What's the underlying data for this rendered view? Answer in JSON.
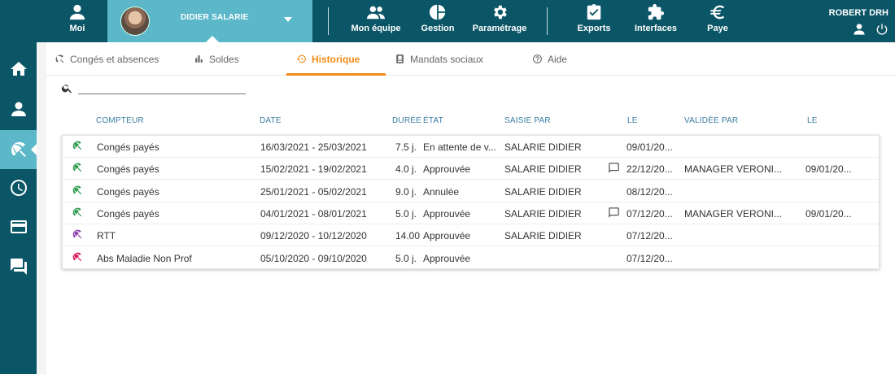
{
  "topnav": {
    "moi": "Moi",
    "user_name": "DIDIER SALARIE",
    "mon_equipe": "Mon équipe",
    "gestion": "Gestion",
    "parametrage": "Paramétrage",
    "exports": "Exports",
    "interfaces": "Interfaces",
    "paye": "Paye",
    "account_name": "ROBERT DRH"
  },
  "sidebar": {
    "items": [
      "home-icon",
      "person-icon",
      "beach-umbrella-icon",
      "clock-icon",
      "card-icon",
      "chat-icon"
    ],
    "active_index": 2
  },
  "tabs": [
    {
      "label": "Congés et absences",
      "icon": "umbrella-icon"
    },
    {
      "label": "Soldes",
      "icon": "bar-chart-icon"
    },
    {
      "label": "Historique",
      "icon": "history-icon",
      "active": true
    },
    {
      "label": "Mandats sociaux",
      "icon": "badge-icon"
    },
    {
      "label": "Aide",
      "icon": "help-icon"
    }
  ],
  "search": {
    "value": "",
    "placeholder": ""
  },
  "columns": {
    "compteur": "COMPTEUR",
    "date": "DATE",
    "duree": "DURÉE",
    "etat": "ÉTAT",
    "saisie_par": "SAISIE PAR",
    "le1": "LE",
    "validee_par": "VALIDÉE PAR",
    "le2": "LE"
  },
  "colors": {
    "topbar": "#0a5566",
    "accent": "#5cb8c9",
    "active_tab": "#f08a14",
    "umbrella_green": "#2e9b4f",
    "umbrella_purple": "#8e44ad",
    "umbrella_pink": "#d81b60"
  },
  "rows": [
    {
      "compteur": "Congés payés",
      "color": "green",
      "date": "16/03/2021 - 25/03/2021",
      "duree": "7.5 j.",
      "etat": "En attente de v...",
      "saisie": "SALARIE DIDIER",
      "comment": false,
      "le1": "09/01/20...",
      "validee": "",
      "le2": ""
    },
    {
      "compteur": "Congés payés",
      "color": "green",
      "date": "15/02/2021 - 19/02/2021",
      "duree": "4.0 j.",
      "etat": "Approuvée",
      "saisie": "SALARIE DIDIER",
      "comment": true,
      "le1": "22/12/20...",
      "validee": "MANAGER VERONI...",
      "le2": "09/01/20..."
    },
    {
      "compteur": "Congés payés",
      "color": "green",
      "date": "25/01/2021 - 05/02/2021",
      "duree": "9.0 j.",
      "etat": "Annulée",
      "saisie": "SALARIE DIDIER",
      "comment": false,
      "le1": "08/12/20...",
      "validee": "",
      "le2": ""
    },
    {
      "compteur": "Congés payés",
      "color": "green",
      "date": "04/01/2021 - 08/01/2021",
      "duree": "5.0 j.",
      "etat": "Approuvée",
      "saisie": "SALARIE DIDIER",
      "comment": true,
      "le1": "07/12/20...",
      "validee": "MANAGER VERONI...",
      "le2": "09/01/20..."
    },
    {
      "compteur": "RTT",
      "color": "purple",
      "date": "09/12/2020 - 10/12/2020",
      "duree": "14.00 ...",
      "etat": "Approuvée",
      "saisie": "SALARIE DIDIER",
      "comment": false,
      "le1": "07/12/20...",
      "validee": "",
      "le2": ""
    },
    {
      "compteur": "Abs Maladie Non Prof",
      "color": "pink",
      "date": "05/10/2020 - 09/10/2020",
      "duree": "5.0 j.",
      "etat": "Approuvée",
      "saisie": "",
      "comment": false,
      "le1": "07/12/20...",
      "validee": "",
      "le2": ""
    }
  ]
}
